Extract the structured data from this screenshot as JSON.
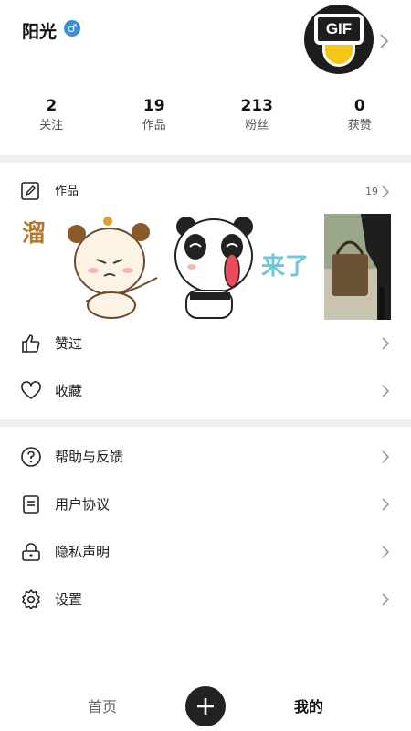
{
  "profile": {
    "username": "阳光",
    "gender_symbol": "♂",
    "gender_color": "#3b8fd9",
    "avatar_text": "GIF"
  },
  "stats": [
    {
      "value": "2",
      "label": "关注"
    },
    {
      "value": "19",
      "label": "作品"
    },
    {
      "value": "213",
      "label": "粉丝"
    },
    {
      "value": "0",
      "label": "获赞"
    }
  ],
  "works": {
    "label": "作品",
    "count": "19",
    "sticker_text_1": "溜",
    "sticker_text_2": "来了"
  },
  "menu_group_1": [
    {
      "label": "赞过",
      "icon": "thumbs-up-icon"
    },
    {
      "label": "收藏",
      "icon": "heart-icon"
    }
  ],
  "menu_group_2": [
    {
      "label": "帮助与反馈",
      "icon": "help-circle-icon"
    },
    {
      "label": "用户协议",
      "icon": "document-icon"
    },
    {
      "label": "隐私声明",
      "icon": "lock-icon"
    },
    {
      "label": "设置",
      "icon": "gear-icon"
    }
  ],
  "bottom_nav": {
    "home": "首页",
    "add_icon": "plus-icon",
    "mine": "我的"
  },
  "colors": {
    "accent": "#222222",
    "divider": "#eeeeee",
    "avatar_yellow": "#f5c518"
  }
}
